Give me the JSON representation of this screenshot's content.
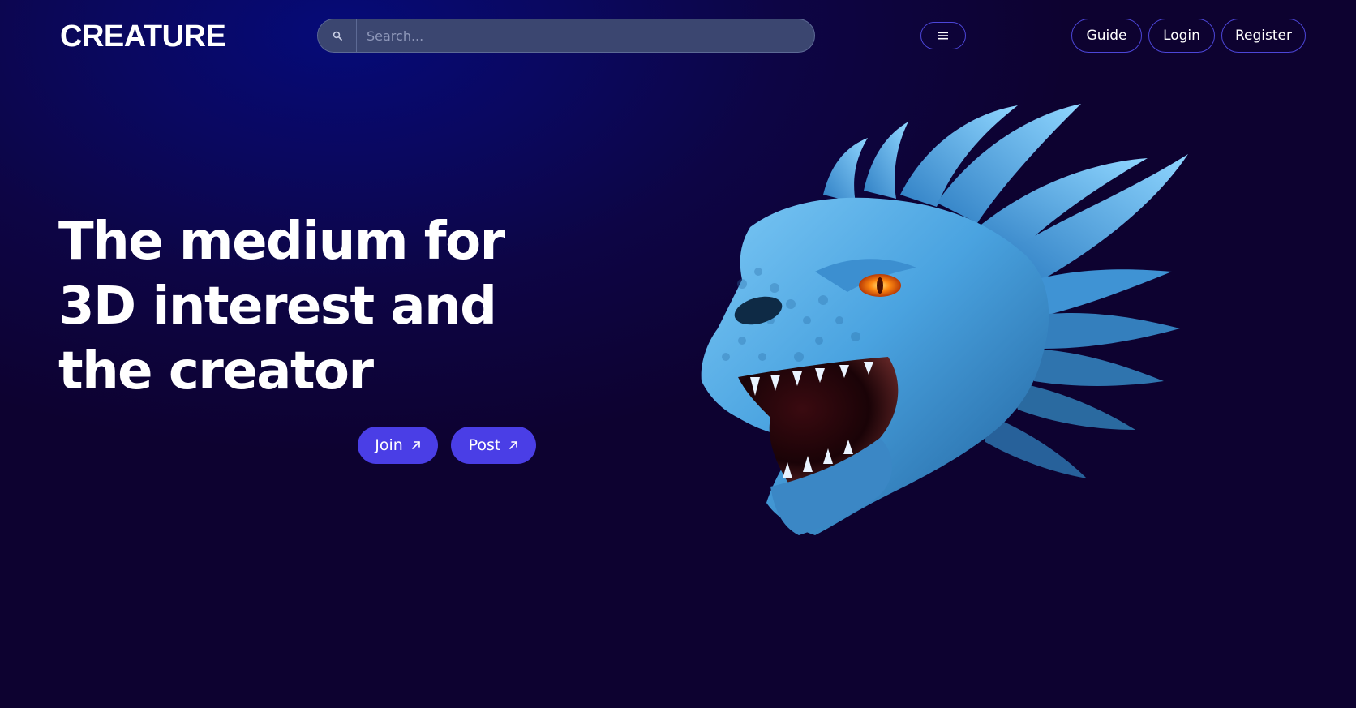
{
  "header": {
    "logo": "CREATURE",
    "search": {
      "placeholder": "Search...",
      "icon": "search-icon"
    },
    "menu_icon": "hamburger-menu-icon",
    "nav": {
      "guide": "Guide",
      "login": "Login",
      "register": "Register"
    }
  },
  "hero": {
    "title": "The medium for 3D interest and the creator",
    "join_label": "Join",
    "post_label": "Post",
    "arrow_icon": "arrow-up-right-icon",
    "image": "blue-dragon-head-3d-render"
  },
  "colors": {
    "background": "#0d0230",
    "accent": "#4a3ee6",
    "button_border": "#4c46d8",
    "search_bg": "#3b4670",
    "dragon_blue": "#4aa3e0",
    "dragon_eye": "#ff7a12"
  }
}
